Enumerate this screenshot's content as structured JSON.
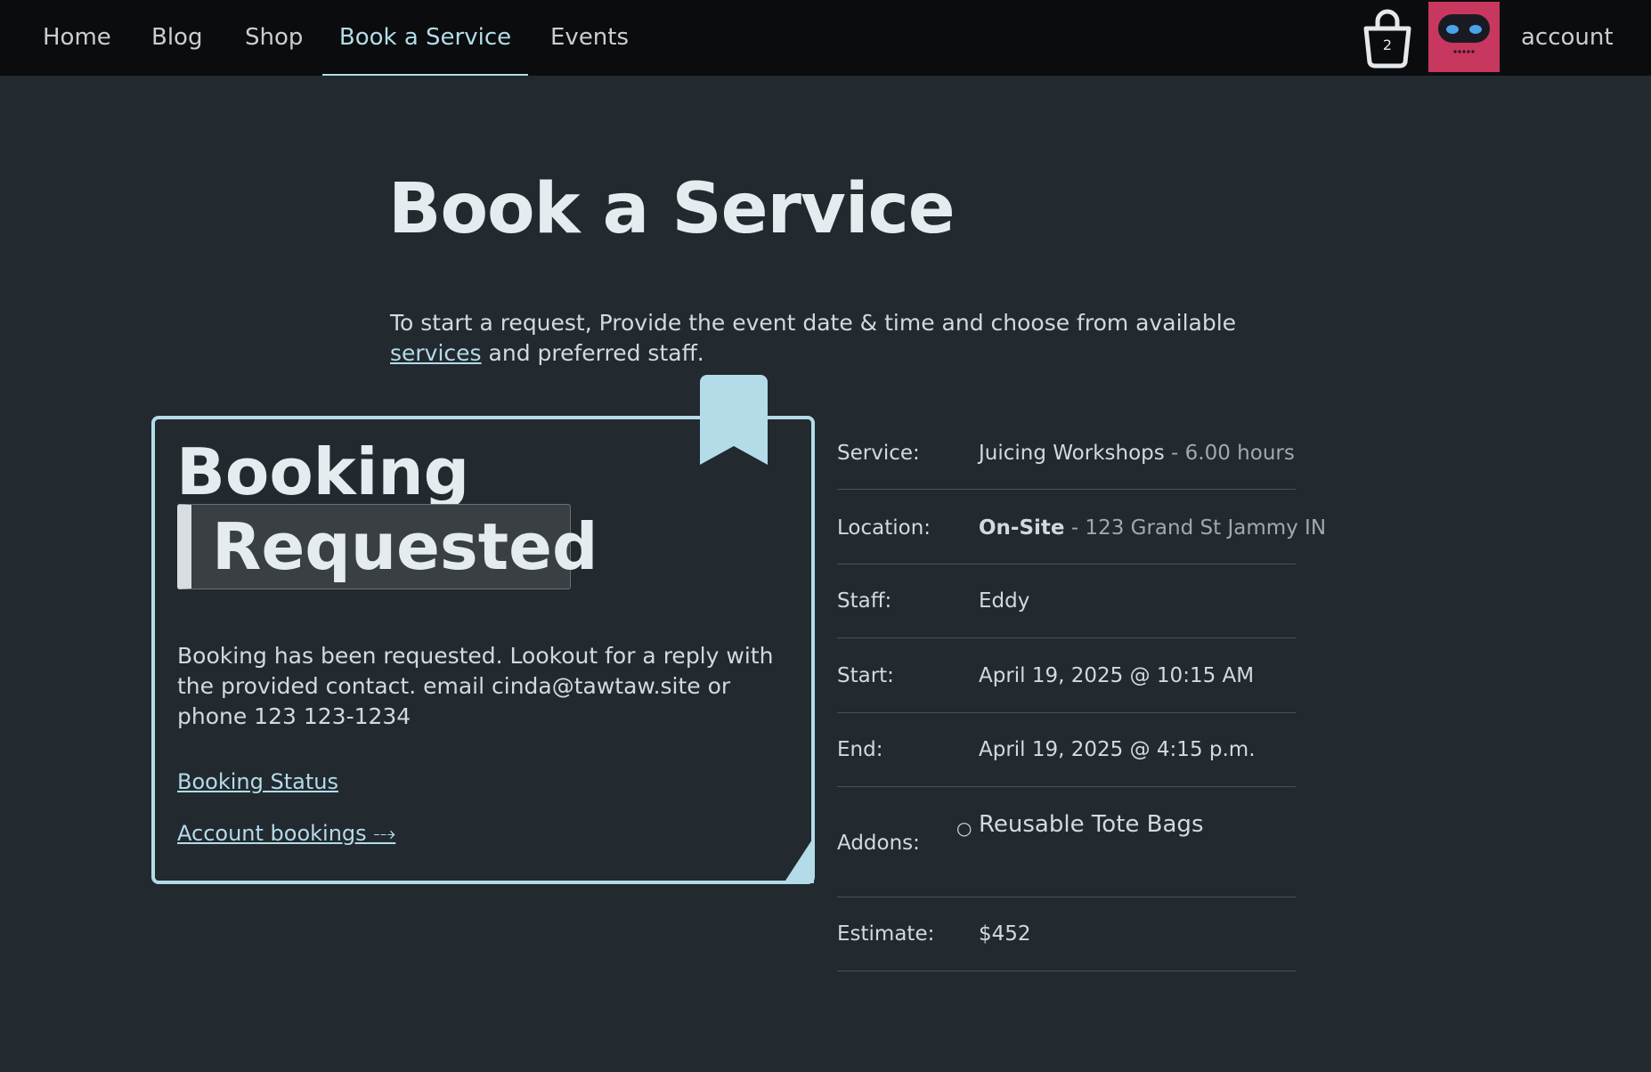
{
  "nav": {
    "items": [
      {
        "label": "Home"
      },
      {
        "label": "Blog"
      },
      {
        "label": "Shop"
      },
      {
        "label": "Book a Service"
      },
      {
        "label": "Events"
      }
    ],
    "active": "Book a Service",
    "cart_count": "2",
    "account_label": "account",
    "avatar_color": "#c8375e"
  },
  "header": {
    "title": "Book a Service",
    "intro_text": "To start a request, Provide the event date & time and choose from available",
    "intro_link": "services",
    "intro_suffix": " and preferred staff."
  },
  "card": {
    "title_line1": "Booking",
    "title_line2": "Requested",
    "message": "Booking has been requested. Lookout for a reply with the provided contact. email cinda@tawtaw.site or phone 123 123-1234",
    "status_link": "Booking Status",
    "account_bookings_link": "Account bookings ⤏",
    "accent_color": "#b4dbe8"
  },
  "details": {
    "service": {
      "label": "Service:",
      "value": "Juicing Workshops",
      "extra": " - 6.00 hours"
    },
    "location": {
      "label": "Location:",
      "value": "On-Site",
      "extra": " - 123 Grand St Jammy IN"
    },
    "staff": {
      "label": "Staff:",
      "value": "Eddy"
    },
    "start": {
      "label": "Start:",
      "value": "April 19, 2025 @ 10:15 AM"
    },
    "end": {
      "label": "End:",
      "value": "April 19, 2025 @ 4:15 p.m."
    },
    "addons": {
      "label": "Addons:",
      "items": [
        "Reusable Tote Bags"
      ]
    },
    "estimate": {
      "label": "Estimate:",
      "value": "$452"
    }
  }
}
